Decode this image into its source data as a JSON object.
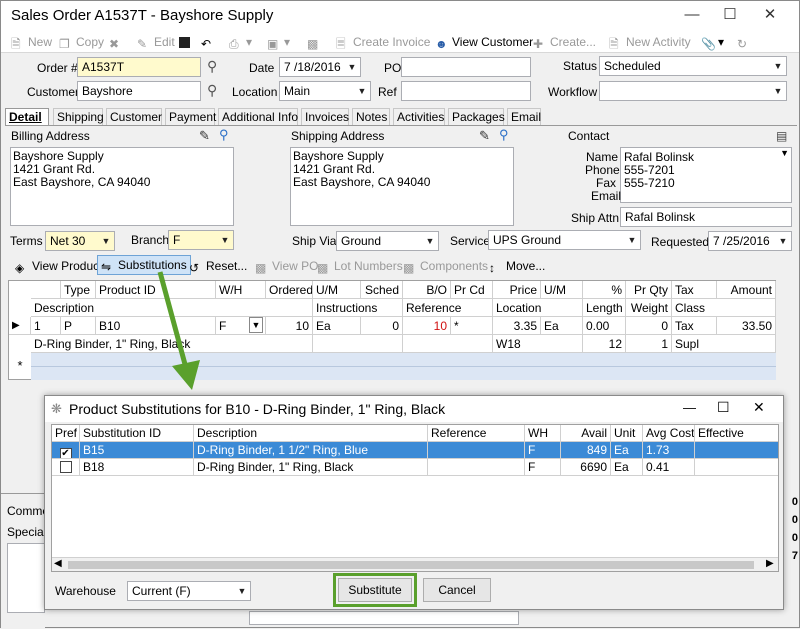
{
  "window": {
    "title": "Sales Order A1537T - Bayshore Supply"
  },
  "toolbar": {
    "new": "New",
    "copy": "Copy",
    "edit": "Edit",
    "create_invoice": "Create Invoice",
    "view_customer": "View Customer",
    "create": "Create...",
    "new_activity": "New Activity"
  },
  "header": {
    "order_label": "Order #",
    "order_value": "A1537T",
    "date_label": "Date",
    "date_value": "7 /18/2016",
    "po_label": "PO",
    "po_value": "",
    "status_label": "Status",
    "status_value": "Scheduled",
    "customer_label": "Customer",
    "customer_value": "Bayshore",
    "location_label": "Location",
    "location_value": "Main",
    "ref_label": "Ref",
    "ref_value": "",
    "workflow_label": "Workflow",
    "workflow_value": ""
  },
  "tabs": [
    "Detail",
    "Shipping",
    "Customer",
    "Payment",
    "Additional Info",
    "Invoices",
    "Notes",
    "Activities",
    "Packages",
    "Email"
  ],
  "billing": {
    "label": "Billing Address",
    "text": "Bayshore Supply\n1421 Grant Rd.\nEast Bayshore, CA 94040"
  },
  "shipping": {
    "label": "Shipping Address",
    "text": "Bayshore Supply\n1421 Grant Rd.\nEast Bayshore, CA 94040"
  },
  "contact": {
    "label": "Contact",
    "name_label": "Name",
    "name": "Rafal Bolinsk",
    "phone_label": "Phone",
    "phone": "555-7201",
    "fax_label": "Fax",
    "fax": "555-7210",
    "email_label": "Email",
    "email": "",
    "shipattn_label": "Ship Attn",
    "shipattn": "Rafal Bolinsk"
  },
  "terms": {
    "terms_label": "Terms",
    "terms_value": "Net 30",
    "branch_label": "Branch",
    "branch_value": "F",
    "shipvia_label": "Ship Via",
    "shipvia_value": "Ground",
    "service_label": "Service",
    "service_value": "UPS Ground",
    "requested_label": "Requested",
    "requested_value": "7 /25/2016"
  },
  "actions": {
    "view_product": "View Product",
    "substitutions": "Substitutions",
    "reset": "Reset...",
    "view_po": "View PO",
    "lot_numbers": "Lot Numbers",
    "components": "Components",
    "move": "Move..."
  },
  "grid": {
    "h1": [
      "Type",
      "Product ID",
      "W/H",
      "Ordered",
      "U/M",
      "Sched",
      "B/O",
      "Pr Cd",
      "Price",
      "U/M",
      "%",
      "Pr Qty",
      "Tax",
      "Amount"
    ],
    "h2": [
      "Description",
      "Instructions",
      "Reference",
      "Location",
      "Length",
      "Weight",
      "Class"
    ],
    "row1": {
      "line": "1",
      "type": "P",
      "product": "B10",
      "wh": "F",
      "ordered": "10",
      "um": "Ea",
      "sched": "0",
      "bo": "10",
      "prcd": "*",
      "price": "3.35",
      "um2": "Ea",
      "pct": "0.00",
      "prqty": "0",
      "tax": "Tax",
      "amount": "33.50"
    },
    "row2": {
      "desc": "D-Ring Binder, 1\" Ring, Black",
      "location": "W18",
      "length": "12",
      "weight": "1",
      "class": "Supl"
    },
    "new_row_marker": "*"
  },
  "lower": {
    "comments": "Commen",
    "special": "Special"
  },
  "dialog": {
    "title": "Product Substitutions for B10 - D-Ring Binder, 1\" Ring, Black",
    "cols": [
      "Pref",
      "Substitution ID",
      "Description",
      "Reference",
      "WH",
      "Avail",
      "Unit",
      "Avg Cost",
      "Effective"
    ],
    "rows": [
      {
        "pref": true,
        "id": "B15",
        "desc": "D-Ring Binder, 1 1/2\" Ring, Blue",
        "ref": "",
        "wh": "F",
        "avail": "849",
        "unit": "Ea",
        "cost": "1.73",
        "eff": ""
      },
      {
        "pref": false,
        "id": "B18",
        "desc": "D-Ring Binder, 1\" Ring, Black",
        "ref": "",
        "wh": "F",
        "avail": "6690",
        "unit": "Ea",
        "cost": "0.41",
        "eff": ""
      }
    ],
    "warehouse_label": "Warehouse",
    "warehouse_value": "Current (F)",
    "substitute": "Substitute",
    "cancel": "Cancel"
  },
  "colors": {
    "highlight": "#3b8ad6",
    "arrow": "#5aa02c",
    "yellow": "#fffacd"
  }
}
